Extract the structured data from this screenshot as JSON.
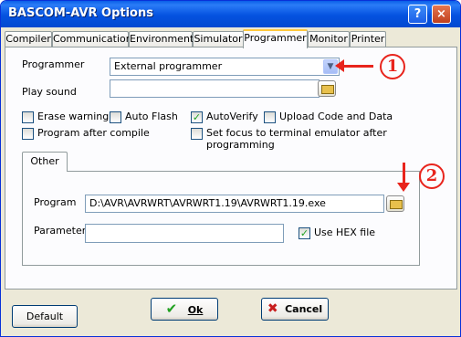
{
  "window": {
    "title": "BASCOM-AVR Options",
    "help_label": "?",
    "close_label": "×"
  },
  "tabs": [
    "Compiler",
    "Communication",
    "Environment",
    "Simulator",
    "Programmer",
    "Monitor",
    "Printer"
  ],
  "active_tab": "Programmer",
  "programmer": {
    "label": "Programmer",
    "value": "External programmer"
  },
  "play_sound": {
    "label": "Play sound",
    "value": ""
  },
  "checkboxes": {
    "erase_warning": {
      "label": "Erase warning",
      "checked": false
    },
    "auto_flash": {
      "label": "Auto Flash",
      "checked": false
    },
    "auto_verify": {
      "label": "AutoVerify",
      "checked": true
    },
    "upload_code": {
      "label": "Upload Code and Data",
      "checked": false
    },
    "program_after_compile": {
      "label": "Program after compile",
      "checked": false
    },
    "set_focus": {
      "label": "Set focus to terminal emulator after programming",
      "checked": false
    }
  },
  "other_group": {
    "tab_label": "Other",
    "program": {
      "label": "Program",
      "value": "D:\\AVR\\AVRWRT\\AVRWRT1.19\\AVRWRT1.19.exe"
    },
    "parameter": {
      "label": "Parameter",
      "value": ""
    },
    "use_hex": {
      "label": "Use HEX file",
      "checked": true
    }
  },
  "buttons": {
    "default": "Default",
    "ok": "Ok",
    "cancel": "Cancel"
  },
  "annotations": {
    "marker1": "1",
    "marker2": "2"
  },
  "colors": {
    "accent": "#e8241c",
    "title_bar": "#0452e0",
    "check": "#21a121"
  }
}
